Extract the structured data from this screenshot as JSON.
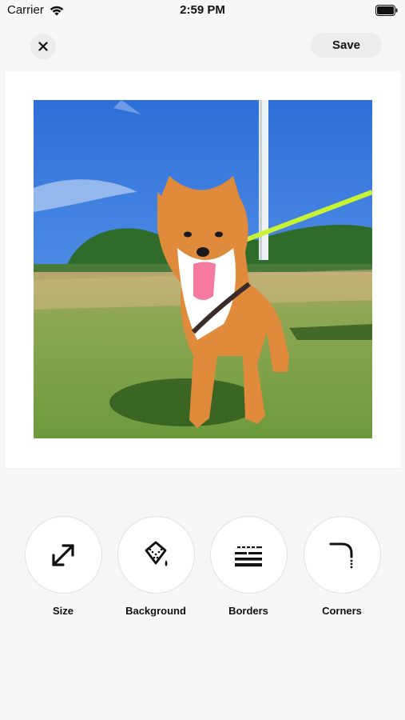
{
  "status_bar": {
    "carrier": "Carrier",
    "time": "2:59 PM",
    "icons": [
      "wifi-icon",
      "battery-icon"
    ]
  },
  "header": {
    "close_icon": "close-icon",
    "save_label": "Save"
  },
  "canvas": {
    "background_color": "#ffffff",
    "photo_description_icon": "photo-image"
  },
  "tools": [
    {
      "label": "Size",
      "icon": "resize-icon"
    },
    {
      "label": "Background",
      "icon": "paint-bucket-icon"
    },
    {
      "label": "Borders",
      "icon": "borders-icon"
    },
    {
      "label": "Corners",
      "icon": "corners-icon"
    }
  ],
  "colors": {
    "page_bg": "#f7f7f7",
    "button_bg": "#ececec",
    "text": "#111111"
  }
}
